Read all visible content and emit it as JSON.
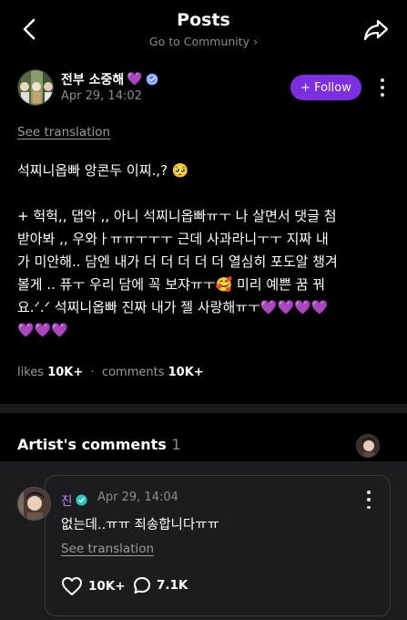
{
  "header": {
    "title": "Posts",
    "subtitle": "Go to Community",
    "subtitle_chevron": "›"
  },
  "post": {
    "author": "전부 소중해",
    "author_emoji": "💜",
    "date": "Apr 29, 14:02",
    "follow_label": "Follow",
    "follow_plus": "+",
    "see_translation": "See translation",
    "body_lines": [
      "석찌니옵빠 앙콘두 이찌.,? 🥺",
      "+ 헉헉,, 댑악 ,, 아니 석찌니옵빠ㅠㅜ 나 살면서 댓글 첨",
      "받아봐 ,, 우와ㅏㅠㅠㅜㅜㅜ 근데 사과라니ㅜㅜ 지짜 내",
      "가 미안해.. 담엔 내가 더 더 더 더 더 열심히 포도알 챙겨",
      "볼게 .. 퓨ㅜ 우리 담에 꼭 보쟈ㅠㅜ🥰 미리 예쁜 꿈 꿔",
      "요.ᐟ.ᐟ 석찌니옵빠 진짜 내가 젤 사랑해ㅠㅜ💜💜💜💜",
      "💜💜💜"
    ],
    "likes_label": "likes",
    "likes_count": "10K+",
    "comments_label": "comments",
    "comments_count": "10K+"
  },
  "artist_comments": {
    "title": "Artist's comments",
    "count": "1",
    "comment": {
      "author": "진",
      "date": "Apr 29, 14:04",
      "text": "없는데..ㅠㅠ 죄송합니다ㅠㅠ",
      "see_translation": "See translation",
      "likes": "10K+",
      "replies": "7.1K"
    }
  },
  "colors": {
    "accent": "#7b2fe0",
    "artist_name": "#c58bff",
    "background": "#000000",
    "card": "#1c1c1e"
  },
  "icons": [
    "back-arrow-icon",
    "share-icon",
    "verified-badge-icon",
    "more-vertical-icon",
    "heart-icon",
    "comment-bubble-icon"
  ]
}
